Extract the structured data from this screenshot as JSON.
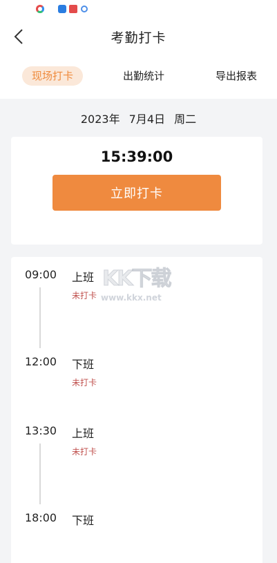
{
  "header": {
    "title": "考勤打卡"
  },
  "tabs": [
    {
      "label": "现场打卡",
      "active": true
    },
    {
      "label": "出勤统计",
      "active": false
    },
    {
      "label": "导出报表",
      "active": false
    }
  ],
  "date": {
    "date": "2023年",
    "day": "7月4日",
    "weekday": "周二"
  },
  "punch": {
    "time": "15:39:00",
    "button_label": "立即打卡"
  },
  "schedule": [
    {
      "time": "09:00",
      "label": "上班",
      "status": "未打卡"
    },
    {
      "time": "12:00",
      "label": "下班",
      "status": "未打卡"
    },
    {
      "time": "13:30",
      "label": "上班",
      "status": "未打卡"
    },
    {
      "time": "18:00",
      "label": "下班",
      "status": ""
    }
  ],
  "watermark": {
    "text": "KK下载",
    "url": "www.kkx.net"
  },
  "colors": {
    "accent": "#ef8a3f",
    "tab_active_bg": "#fbe8d9",
    "status_red": "#c0504d",
    "page_bg": "#f3f4f6"
  }
}
